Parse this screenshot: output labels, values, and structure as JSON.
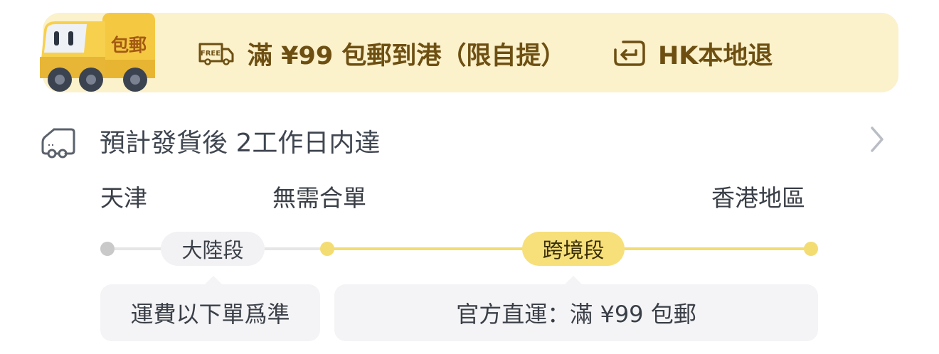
{
  "banner": {
    "truck_label": "包郵",
    "free_badge": "FREE",
    "free_shipping": "滿 ¥99 包郵到港（限自提）",
    "hk_return": "HK本地退",
    "colors": {
      "background": "#fbf1cb",
      "text": "#6d4f12",
      "truck": "#f5c842"
    }
  },
  "delivery": {
    "estimate": "預計發貨後 2工作日内達"
  },
  "route": {
    "origin": "天津",
    "merge_note": "無需合單",
    "destination": "香港地區",
    "segments": [
      {
        "label": "大陸段",
        "note": "運費以下單爲準"
      },
      {
        "label": "跨境段",
        "note": "官方直運：滿 ¥99 包郵"
      }
    ],
    "colors": {
      "inactive": "#c9c9c9",
      "active": "#f3dc72",
      "pill_active": "#f7e07a"
    }
  }
}
